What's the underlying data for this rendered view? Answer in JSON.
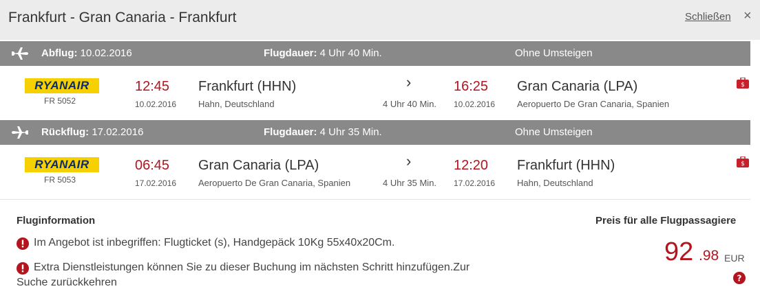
{
  "header": {
    "title": "Frankfurt - Gran Canaria - Frankfurt",
    "close_label": "Schließen",
    "close_icon": "×"
  },
  "legs": [
    {
      "direction_label": "Abflug:",
      "direction_date": "10.02.2016",
      "duration_label": "Flugdauer:",
      "duration_value": "4 Uhr 40 Min.",
      "stops": "Ohne Umsteigen",
      "airline_logo": "RYANAIR",
      "flight_no": "FR 5052",
      "dep_time": "12:45",
      "dep_date": "10.02.2016",
      "dep_city": "Frankfurt (HHN)",
      "dep_airport": "Hahn, Deutschland",
      "arrow": "›",
      "leg_duration": "4 Uhr 40 Min.",
      "arr_time": "16:25",
      "arr_date": "10.02.2016",
      "arr_city": "Gran Canaria (LPA)",
      "arr_airport": "Aeropuerto De Gran Canaria, Spanien"
    },
    {
      "direction_label": "Rückflug:",
      "direction_date": "17.02.2016",
      "duration_label": "Flugdauer:",
      "duration_value": "4 Uhr 35 Min.",
      "stops": "Ohne Umsteigen",
      "airline_logo": "RYANAIR",
      "flight_no": "FR 5053",
      "dep_time": "06:45",
      "dep_date": "17.02.2016",
      "dep_city": "Gran Canaria (LPA)",
      "dep_airport": "Aeropuerto De Gran Canaria, Spanien",
      "arrow": "›",
      "leg_duration": "4 Uhr 35 Min.",
      "arr_time": "12:20",
      "arr_date": "17.02.2016",
      "arr_city": "Frankfurt (HHN)",
      "arr_airport": "Hahn, Deutschland"
    }
  ],
  "info": {
    "title": "Fluginformation",
    "line1": "Im Angebot ist inbegriffen: Flugticket (s), Handgepäck 10Kg 55x40x20Cm.",
    "line2a": "Extra Dienstleistungen können Sie zu dieser Buchung im nächsten Schritt hinzufügen.Zur",
    "line2b": "Suche zurückkehren"
  },
  "price": {
    "label": "Preis für alle Flugpassagiere",
    "integer": "92",
    "decimal": ".98",
    "currency": "EUR"
  },
  "colors": {
    "accent_red": "#b3141d",
    "header_grey": "#898989",
    "ryanair_yellow": "#f6d000",
    "ryanair_blue": "#0a2b6e"
  },
  "icons": {
    "departure": "plane-takeoff-icon",
    "return": "plane-landing-icon",
    "baggage": "suitcase-icon",
    "info": "exclamation-icon",
    "help": "question-icon"
  }
}
